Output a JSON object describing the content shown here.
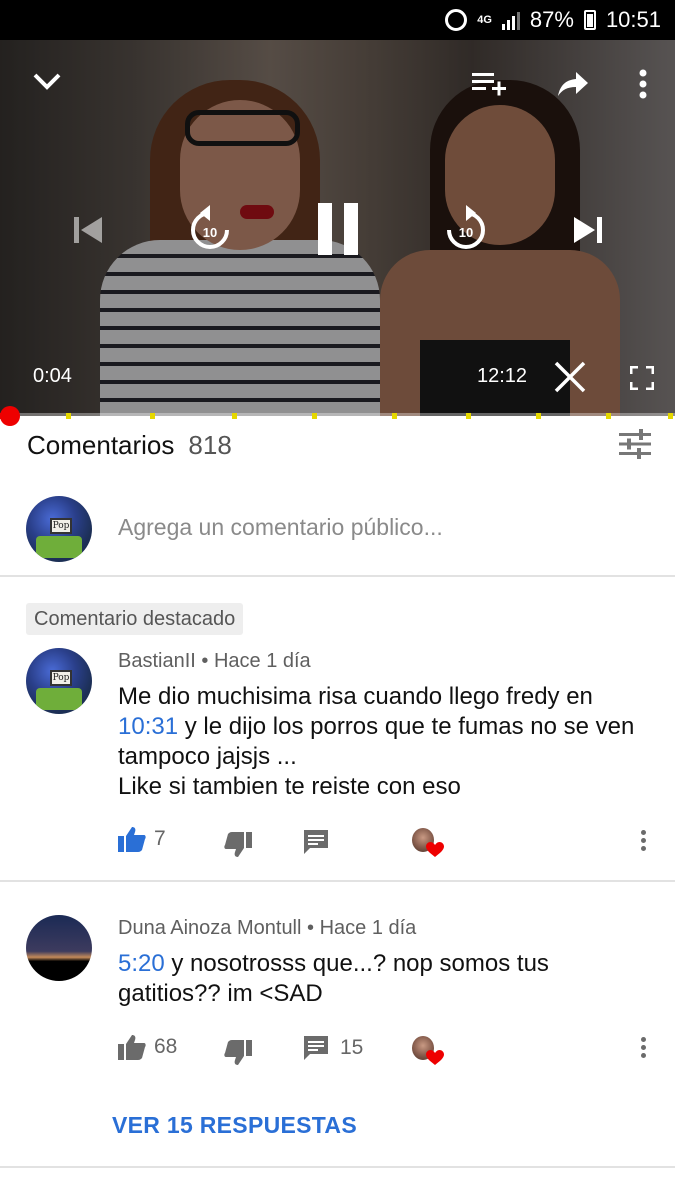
{
  "status_bar": {
    "network": "4G",
    "battery": "87%",
    "time": "10:51"
  },
  "player": {
    "current_time": "0:04",
    "duration": "12:12",
    "progress_fraction": 0.006
  },
  "comments": {
    "title": "Comentarios",
    "count": "818",
    "add_placeholder": "Agrega un comentario público...",
    "pinned_label": "Comentario destacado",
    "items": [
      {
        "author": "BastianII",
        "age": "Hace 1 día",
        "text_before": "Me dio muchisima risa cuando llego fredy en",
        "timestamp": "10:31",
        "text_after": " y le dijo los porros que te fumas no se ven tampoco jajsjs ...",
        "text_line2": "Like si tambien te reiste con eso",
        "likes": "7",
        "replies_count": ""
      },
      {
        "author": "Duna Ainoza Montull",
        "age": "Hace 1 día",
        "timestamp": "5:20",
        "text_after": " y nosotrosss que...?  nop somos tus gatitios?? im <SAD",
        "likes": "68",
        "replies_count": "15"
      }
    ],
    "view_replies_label": "VER 15 RESPUESTAS"
  },
  "icons": [
    "alarm-icon",
    "network-icon",
    "signal-icon",
    "battery-icon",
    "collapse-icon",
    "add-to-queue-icon",
    "share-icon",
    "more-icon",
    "previous-icon",
    "rewind-10-icon",
    "pause-icon",
    "forward-10-icon",
    "next-icon",
    "close-icon",
    "fullscreen-icon",
    "sort-icon",
    "thumb-up-icon",
    "thumb-down-icon",
    "reply-icon",
    "creator-heart-icon"
  ],
  "colors": {
    "accent_blue": "#2a6fd6",
    "progress_red": "#ee0000",
    "ad_marker_yellow": "#e5d800"
  }
}
